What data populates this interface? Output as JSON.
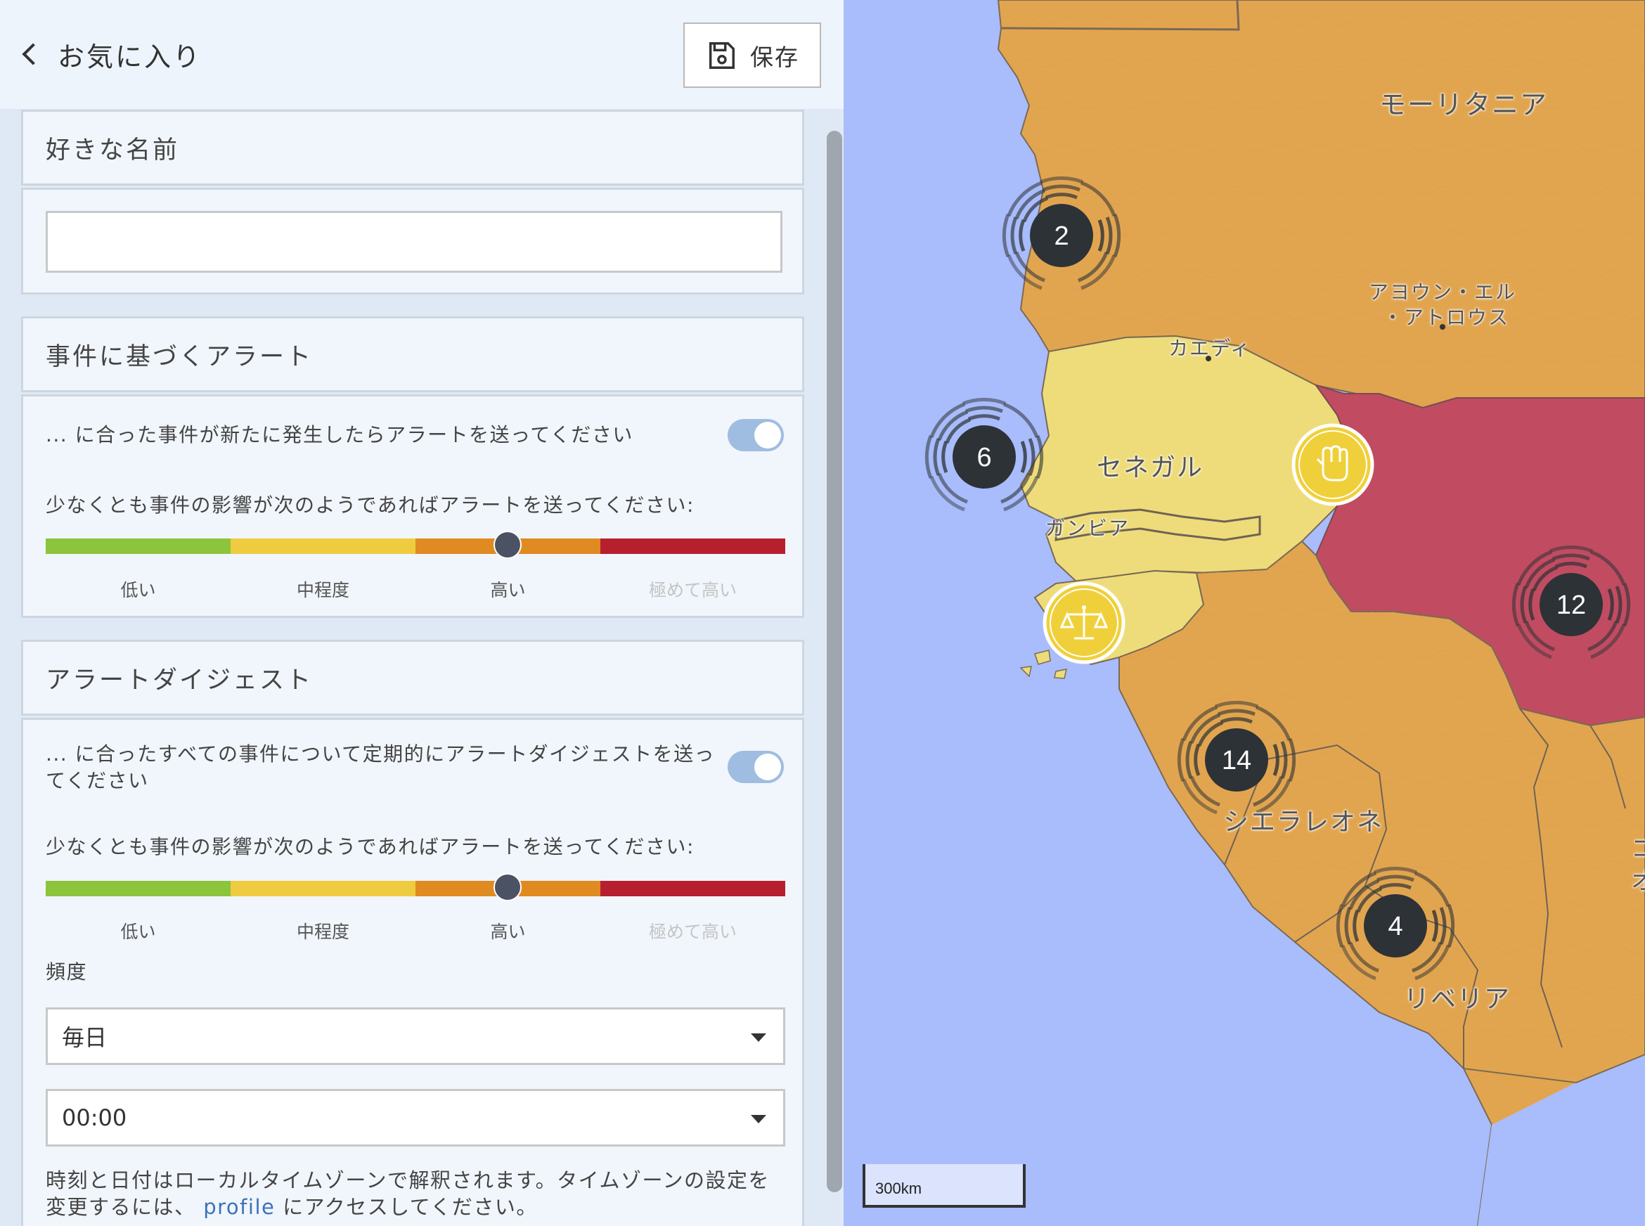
{
  "header": {
    "back_label": "お気に入り",
    "save_label": "保存"
  },
  "name_section": {
    "title": "好きな名前",
    "input_value": ""
  },
  "incident_alert": {
    "title": "事件に基づくアラート",
    "toggle_label": "... に合った事件が新たに発生したらアラートを送ってください",
    "toggle_on": true,
    "impact_label": "少なくとも事件の影響が次のようであればアラートを送ってください:",
    "levels": [
      "低い",
      "中程度",
      "高い",
      "極めて高い"
    ],
    "selected_level": "高い"
  },
  "digest": {
    "title": "アラートダイジェスト",
    "toggle_label": "... に合ったすべての事件について定期的にアラートダイジェストを送ってください",
    "toggle_on": true,
    "impact_label": "少なくとも事件の影響が次のようであればアラートを送ってください:",
    "levels": [
      "低い",
      "中程度",
      "高い",
      "極めて高い"
    ],
    "selected_level": "高い",
    "frequency_label": "頻度",
    "frequency_value": "毎日",
    "time_value": "00:00",
    "note_prefix": "時刻と日付はローカルタイムゾーンで解釈されます。タイムゾーンの設定を変更するには、",
    "note_link": "profile",
    "note_suffix": "にアクセスしてください。"
  },
  "colors": {
    "severity": [
      "#8cc43c",
      "#efcb3f",
      "#e08a22",
      "#b71f2f"
    ],
    "country_orange": "#e2a54f",
    "country_yellow": "#eedc7a",
    "country_red": "#c14c61",
    "ocean": "#a9bcfb",
    "cluster": "#2d3237"
  },
  "map": {
    "labels": {
      "mauritania": "モーリタニア",
      "aioun_line1": "アヨウン・エル",
      "aioun_line2": "・アトロウス",
      "kaedi": "カエディ",
      "senegal": "セネガル",
      "gambia": "ガンビア",
      "sierra_leone": "シエラレオネ",
      "liberia": "リベリア",
      "edge_1": "コ",
      "edge_2": "オ"
    },
    "clusters": [
      {
        "name": "cluster-2",
        "count": "2"
      },
      {
        "name": "cluster-6",
        "count": "6"
      },
      {
        "name": "cluster-12",
        "count": "12"
      },
      {
        "name": "cluster-14",
        "count": "14"
      },
      {
        "name": "cluster-4",
        "count": "4"
      }
    ],
    "event_icons": [
      "protest-icon",
      "justice-scale-icon"
    ],
    "scale": "300km"
  }
}
